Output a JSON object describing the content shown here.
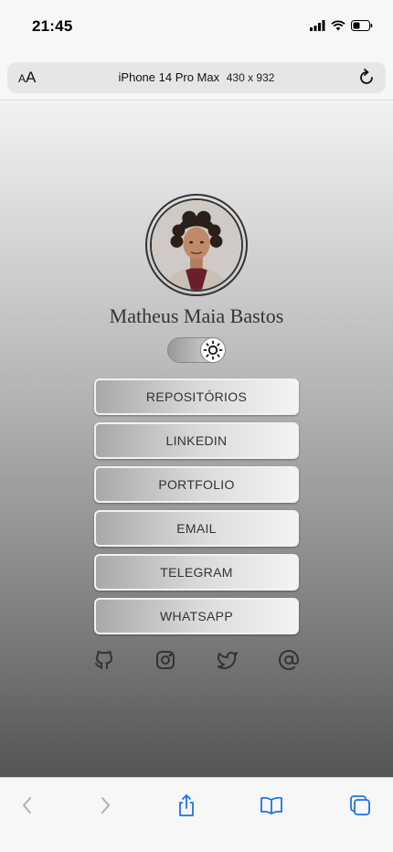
{
  "status_bar": {
    "time": "21:45"
  },
  "address_bar": {
    "aa_small": "A",
    "aa_large": "A",
    "device": "iPhone 14 Pro Max",
    "dimensions": "430 x 932"
  },
  "profile": {
    "name": "Matheus Maia Bastos"
  },
  "links": [
    {
      "label": "REPOSITÓRIOS"
    },
    {
      "label": "LINKEDIN"
    },
    {
      "label": "PORTFOLIO"
    },
    {
      "label": "EMAIL"
    },
    {
      "label": "TELEGRAM"
    },
    {
      "label": "WHATSAPP"
    }
  ],
  "socials": [
    "github-icon",
    "instagram-icon",
    "twitter-icon",
    "at-sign-icon"
  ],
  "toolbar": [
    "back-icon",
    "forward-icon",
    "share-icon",
    "bookmarks-icon",
    "tabs-icon"
  ],
  "colors": {
    "accent": "#1a73e8",
    "text": "#333333",
    "disabled": "#b0b0b0"
  }
}
